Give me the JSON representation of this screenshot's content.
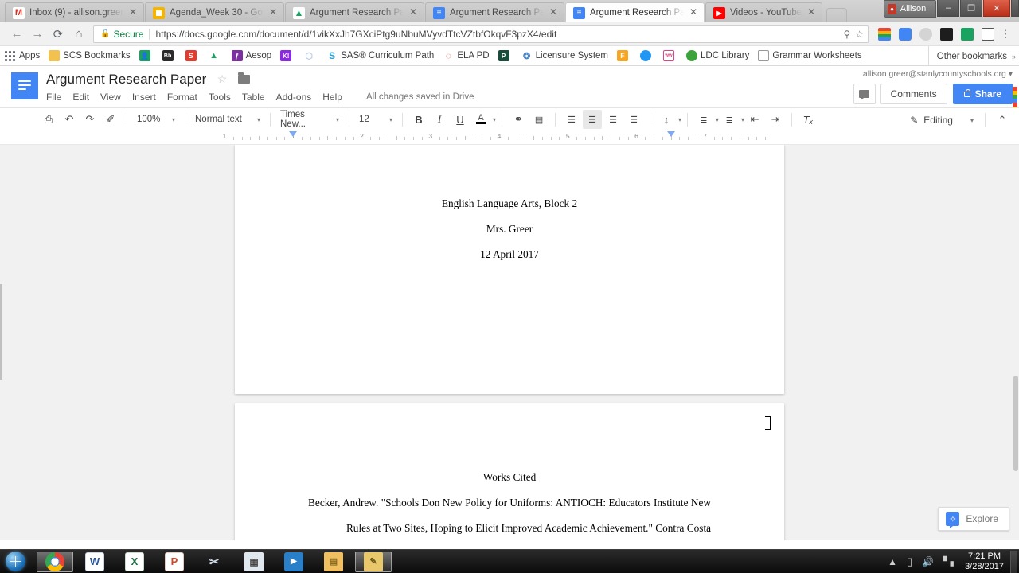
{
  "browser": {
    "tabs": [
      {
        "title": "Inbox (9) - allison.green",
        "favicon": "gmail-icon",
        "color": "#ffffff",
        "glyph": "M",
        "glyph_color": "#d93025",
        "active": false
      },
      {
        "title": "Agenda_Week 30 - Goo",
        "favicon": "google-slides-icon",
        "color": "#f4b400",
        "glyph": "",
        "glyph_color": "#ffffff",
        "active": false
      },
      {
        "title": "Argument Research Pap",
        "favicon": "google-drive-icon",
        "color": "#ffffff",
        "glyph": "▲",
        "glyph_color": "#1aa260",
        "active": false
      },
      {
        "title": "Argument Research Pap",
        "favicon": "google-docs-icon",
        "color": "#4285f4",
        "glyph": "≡",
        "glyph_color": "#ffffff",
        "active": false
      },
      {
        "title": "Argument Research Pap",
        "favicon": "google-docs-icon",
        "color": "#4285f4",
        "glyph": "≡",
        "glyph_color": "#ffffff",
        "active": true
      },
      {
        "title": "Videos - YouTube",
        "favicon": "youtube-icon",
        "color": "#ff0000",
        "glyph": "▶",
        "glyph_color": "#ffffff",
        "active": false
      }
    ],
    "close_label": "✕",
    "new_tab_label": "",
    "window": {
      "user": "Allison",
      "minimize": "–",
      "maximize": "❐",
      "close": "✕"
    },
    "nav": {
      "back": "←",
      "forward": "→",
      "reload": "⟳",
      "home": "⌂",
      "secure_label": "Secure",
      "url": "https://docs.google.com/document/d/1vikXxJh7GXciPtg9uNbuMVyvdTtcVZtbfOkqvF3pzX4/edit",
      "search_icon": "⚲",
      "star_icon": "☆",
      "menu_icon": "⋮"
    },
    "extensions": [
      {
        "name": "colorful-extension-icon",
        "color": "#e8453c"
      },
      {
        "name": "blue-doc-extension-icon",
        "color": "#4285f4"
      },
      {
        "name": "gray-extension-icon",
        "color": "#cfcfcf"
      },
      {
        "name": "red-film-extension-icon",
        "color": "#222222"
      },
      {
        "name": "green-contact-extension-icon",
        "color": "#1aa260"
      },
      {
        "name": "dark-square-extension-icon",
        "color": "#555555"
      }
    ],
    "bookmarks": {
      "apps_label": "Apps",
      "items": [
        {
          "label": "SCS Bookmarks",
          "icon": "folder-icon",
          "color": "#f2c14e",
          "glyph": ""
        },
        {
          "label": "",
          "icon": "contacts-icon",
          "color": "#1aa260",
          "glyph": "■"
        },
        {
          "label": "",
          "icon": "blackboard-icon",
          "color": "#2b2b2b",
          "glyph": "Bb"
        },
        {
          "label": "",
          "icon": "schoology-icon",
          "color": "#e33b2e",
          "glyph": "S"
        },
        {
          "label": "",
          "icon": "google-drive-icon",
          "color": "#ffffff",
          "glyph": "▲"
        },
        {
          "label": "Aesop",
          "icon": "aesop-icon",
          "color": "#7b2fa0",
          "glyph": "ƒ"
        },
        {
          "label": "",
          "icon": "kahoot-icon",
          "color": "#8a2be2",
          "glyph": "K!"
        },
        {
          "label": "",
          "icon": "molecule-icon",
          "color": "#dfe7f5",
          "glyph": "⬡"
        },
        {
          "label": "SAS® Curriculum Path",
          "icon": "sas-icon",
          "color": "#ffffff",
          "glyph": "S"
        },
        {
          "label": "ELA PD",
          "icon": "ela-pd-icon",
          "color": "#ffffff",
          "glyph": "◌"
        },
        {
          "label": "",
          "icon": "pearson-icon",
          "color": "#1b4b3a",
          "glyph": "P"
        },
        {
          "label": "Licensure System",
          "icon": "licensure-icon",
          "color": "#ffffff",
          "glyph": "⁂"
        },
        {
          "label": "",
          "icon": "orange-f-icon",
          "color": "#f6a623",
          "glyph": "F"
        },
        {
          "label": "",
          "icon": "blue-chat-icon",
          "color": "#2196f3",
          "glyph": "●"
        },
        {
          "label": "",
          "icon": "circle-outline-icon",
          "color": "#ffffff",
          "glyph": "○"
        },
        {
          "label": "LDC Library",
          "icon": "ldc-icon",
          "color": "#3ca33c",
          "glyph": "●"
        },
        {
          "label": "Grammar Worksheets",
          "icon": "page-icon",
          "color": "#ffffff",
          "glyph": "□"
        }
      ],
      "other_bookmarks": "Other bookmarks"
    }
  },
  "docs": {
    "logo_name": "google-docs-logo",
    "title": "Argument Research Paper",
    "star_icon": "☆",
    "folder_icon": "folder-icon",
    "menu": [
      "File",
      "Edit",
      "View",
      "Insert",
      "Format",
      "Tools",
      "Table",
      "Add-ons",
      "Help"
    ],
    "save_state": "All changes saved in Drive",
    "account": "allison.greer@stanlycountyschools.org",
    "account_caret": "▾",
    "comment_icon_name": "comment-bubble-icon",
    "comments_label": "Comments",
    "share_label": "Share",
    "toolbar": {
      "print": "⎙",
      "undo": "↶",
      "redo": "↷",
      "paint_format": "✐",
      "zoom": "100%",
      "style": "Normal text",
      "font": "Times New...",
      "font_size": "12",
      "bold": "B",
      "italic": "I",
      "underline": "U",
      "text_color": "A",
      "link": "⚭",
      "comment_add": "☰",
      "align_left": "≡",
      "align_center": "≡",
      "align_right": "≡",
      "align_justify": "≡",
      "line_spacing": "↕",
      "numbered_list": "≣",
      "bulleted_list": "≣",
      "indent_less": "⇤",
      "indent_more": "⇥",
      "clear_format": "Tₓ",
      "mode_label": "Editing",
      "mode_caret": "▾",
      "collapse_icon": "⌃",
      "caret": "▾",
      "active_alignment": "center"
    },
    "ruler": {
      "numbers": [
        "1",
        "2",
        "3",
        "4",
        "5",
        "6",
        "7"
      ],
      "left_indent_in": 0.0,
      "right_indent_in": 6.5
    },
    "document": {
      "page1_lines": [
        "English Language Arts, Block 2",
        "Mrs. Greer",
        "12 April 2017"
      ],
      "page2_heading": "Works Cited",
      "page2_lines": [
        "Becker, Andrew. \"Schools Don New Policy for Uniforms: ANTIOCH: Educators Institute New",
        "Rules at Two Sites, Hoping to Elicit Improved Academic Achievement.\" Contra Costa"
      ]
    },
    "explore_label": "Explore",
    "explore_icon": "explore-star-icon"
  },
  "taskbar": {
    "start_name": "windows-start-orb",
    "items": [
      {
        "name": "chrome",
        "glyph": "",
        "color": "#f2f2f2",
        "active": true
      },
      {
        "name": "word",
        "glyph": "W",
        "color": "#2b579a",
        "active": false
      },
      {
        "name": "excel",
        "glyph": "X",
        "color": "#217346",
        "active": false
      },
      {
        "name": "powerpoint",
        "glyph": "P",
        "color": "#d24726",
        "active": false
      },
      {
        "name": "snipping-tool",
        "glyph": "✂",
        "color": "#e8eef6",
        "active": false
      },
      {
        "name": "calculator",
        "glyph": "▦",
        "color": "#dfe7ef",
        "active": false
      },
      {
        "name": "media-player",
        "glyph": "▶",
        "color": "#2a7fc9",
        "active": false
      },
      {
        "name": "file-explorer",
        "glyph": "▤",
        "color": "#f0c060",
        "active": false
      },
      {
        "name": "notepad",
        "glyph": "✎",
        "color": "#e8c86a",
        "active": false
      }
    ],
    "tray": {
      "show_hidden": "▲",
      "battery": "▯",
      "volume": "🔊",
      "network": "▂▄▆",
      "time": "7:21 PM",
      "date": "3/28/2017"
    }
  }
}
